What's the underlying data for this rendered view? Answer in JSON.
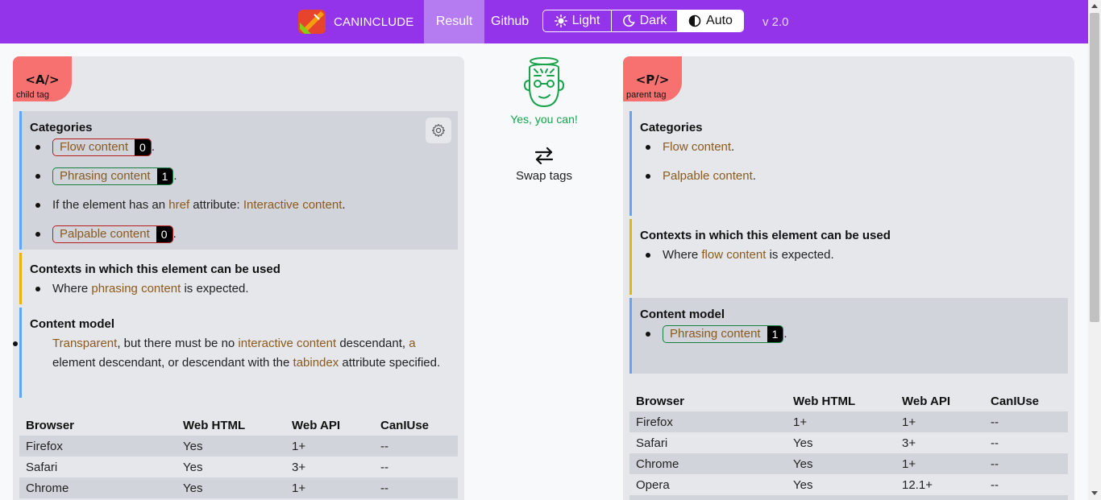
{
  "header": {
    "brand": "CANINCLUDE",
    "nav_result": "Result",
    "nav_github": "Github",
    "theme": {
      "light": "Light",
      "dark": "Dark",
      "auto": "Auto",
      "selected": "Auto"
    },
    "version": "v 2.0"
  },
  "middle": {
    "verdict": "Yes, you can!",
    "swap_label": "Swap tags"
  },
  "left": {
    "tag": "<A/>",
    "role": "child tag",
    "categories_title": "Categories",
    "categories": [
      {
        "label": "Flow content",
        "count": "0"
      },
      {
        "label": "Phrasing content",
        "count": "1"
      },
      {
        "prefix": "If the element has an ",
        "attr": "href",
        "middle": " attribute: ",
        "link": "Interactive content"
      },
      {
        "label": "Palpable content",
        "count": "0"
      }
    ],
    "contexts_title": "Contexts in which this element can be used",
    "contexts_pre": "Where ",
    "contexts_link": "phrasing content",
    "contexts_post": " is expected.",
    "model_title": "Content model",
    "model": {
      "l1": "Transparent",
      "t1": ", but there must be no ",
      "l2": "interactive content",
      "t2": " descendant, ",
      "l3": "a",
      "t3": " element descendant, or descendant with the ",
      "l4": "tabindex",
      "t4": " attribute specified."
    },
    "table_headers": [
      "Browser",
      "Web HTML",
      "Web API",
      "CanIUse"
    ],
    "table_rows": [
      [
        "Firefox",
        "Yes",
        "1+",
        "--"
      ],
      [
        "Safari",
        "Yes",
        "3+",
        "--"
      ],
      [
        "Chrome",
        "Yes",
        "1+",
        "--"
      ]
    ]
  },
  "right": {
    "tag": "<P/>",
    "role": "parent tag",
    "categories_title": "Categories",
    "categories": [
      {
        "link": "Flow content"
      },
      {
        "link": "Palpable content"
      }
    ],
    "contexts_title": "Contexts in which this element can be used",
    "contexts_pre": "Where ",
    "contexts_link": "flow content",
    "contexts_post": " is expected.",
    "model_title": "Content model",
    "model_pill": {
      "label": "Phrasing content",
      "count": "1"
    },
    "table_headers": [
      "Browser",
      "Web HTML",
      "Web API",
      "CanIUse"
    ],
    "table_rows": [
      [
        "Firefox",
        "1+",
        "1+",
        "--"
      ],
      [
        "Safari",
        "Yes",
        "3+",
        "--"
      ],
      [
        "Chrome",
        "Yes",
        "1+",
        "--"
      ],
      [
        "Opera",
        "Yes",
        "12.1+",
        "--"
      ]
    ]
  },
  "colors": {
    "header_bg": "#9333ea",
    "tag_badge": "#f87171",
    "link": "#8a5a1e",
    "success": "#16a34a"
  }
}
